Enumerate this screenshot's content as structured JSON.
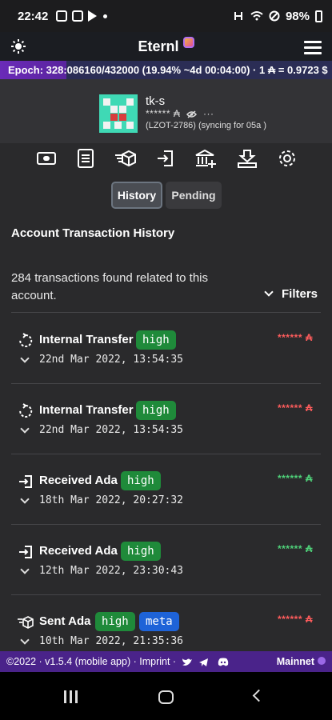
{
  "status_bar": {
    "time": "22:42",
    "battery": "98%"
  },
  "app": {
    "title": "Eternl"
  },
  "epoch_bar": {
    "text": "Epoch: 328:086160/432000 (19.94% ~4d 00:04:00) · 1 ₳ = 0.9723 $"
  },
  "account": {
    "name": "tk-s",
    "balance_masked": "****** ₳",
    "more": "···",
    "subtitle": "(LZOT-2786) (syncing for 05a )"
  },
  "tabs": [
    {
      "icon": "wallet-icon"
    },
    {
      "icon": "document-icon"
    },
    {
      "icon": "send-cube-icon"
    },
    {
      "icon": "receive-icon"
    },
    {
      "icon": "bank-icon"
    },
    {
      "icon": "stake-icon"
    },
    {
      "icon": "gear-icon"
    }
  ],
  "segments": {
    "history": "History",
    "pending": "Pending"
  },
  "section_title": "Account Transaction History",
  "summary": {
    "count_text": "284 transactions found related to this account.",
    "filters_label": "Filters"
  },
  "transactions": [
    {
      "type": "Internal Transfer",
      "badge": "high",
      "amount": "****** ₳",
      "amount_color": "red",
      "date": "22nd Mar 2022, 13:54:35",
      "icon": "internal-transfer-icon"
    },
    {
      "type": "Internal Transfer",
      "badge": "high",
      "amount": "****** ₳",
      "amount_color": "red",
      "date": "22nd Mar 2022, 13:54:35",
      "icon": "internal-transfer-icon"
    },
    {
      "type": "Received Ada",
      "badge": "high",
      "amount": "****** ₳",
      "amount_color": "green",
      "date": "18th Mar 2022, 20:27:32",
      "icon": "receive-icon"
    },
    {
      "type": "Received Ada",
      "badge": "high",
      "amount": "****** ₳",
      "amount_color": "green",
      "date": "12th Mar 2022, 23:30:43",
      "icon": "receive-icon"
    },
    {
      "type": "Sent Ada",
      "badge": "high",
      "badge2": "meta",
      "amount": "****** ₳",
      "amount_color": "red",
      "date": "10th Mar 2022, 21:35:36",
      "icon": "send-icon"
    }
  ],
  "footer": {
    "text": "©2022 · v1.5.4 (mobile app) · Imprint ·",
    "network": "Mainnet"
  }
}
